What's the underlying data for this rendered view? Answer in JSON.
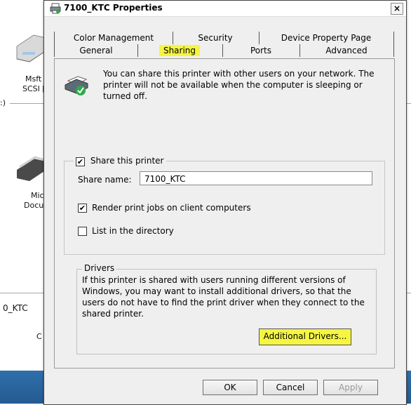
{
  "background": {
    "device1_label_line1": "Msft \\",
    "device1_label_line2": "SCSI [",
    "device2_label_line1": "Micr",
    "device2_label_line2": "Docun",
    "fragment_text": ":)",
    "fragment_text2": "0_KTC",
    "fragment_text3": "C"
  },
  "dialog": {
    "title": "7100_KTC Properties",
    "close_label": "×",
    "tabs_row1": [
      "Color Management",
      "Security",
      "Device Property Page"
    ],
    "tabs_row2": [
      "General",
      "Sharing",
      "Ports",
      "Advanced"
    ],
    "active_tab": "Sharing",
    "description": "You can share this printer with other users on your network. The printer will not be available when the computer is sleeping or turned off.",
    "share_printer_label": "Share this printer",
    "share_printer_checked": true,
    "share_name_label": "Share name:",
    "share_name_value": "7100_KTC",
    "render_jobs_label": "Render print jobs on client computers",
    "render_jobs_checked": true,
    "list_directory_label": "List in the directory",
    "list_directory_checked": false,
    "drivers_title": "Drivers",
    "drivers_text": "If this printer is shared with users running different versions of Windows, you may want to install additional drivers, so that the users do not have to find the print driver when they connect to the shared printer.",
    "additional_drivers_label": "Additional Drivers...",
    "ok_label": "OK",
    "cancel_label": "Cancel",
    "apply_label": "Apply"
  },
  "colors": {
    "highlight": "#f5f542",
    "dialog_bg": "#efefef",
    "taskbar_blue": "#2f6fab"
  },
  "icons": {
    "title": "printer-icon",
    "share": "shared-printer-icon",
    "device": "drive-icon"
  }
}
